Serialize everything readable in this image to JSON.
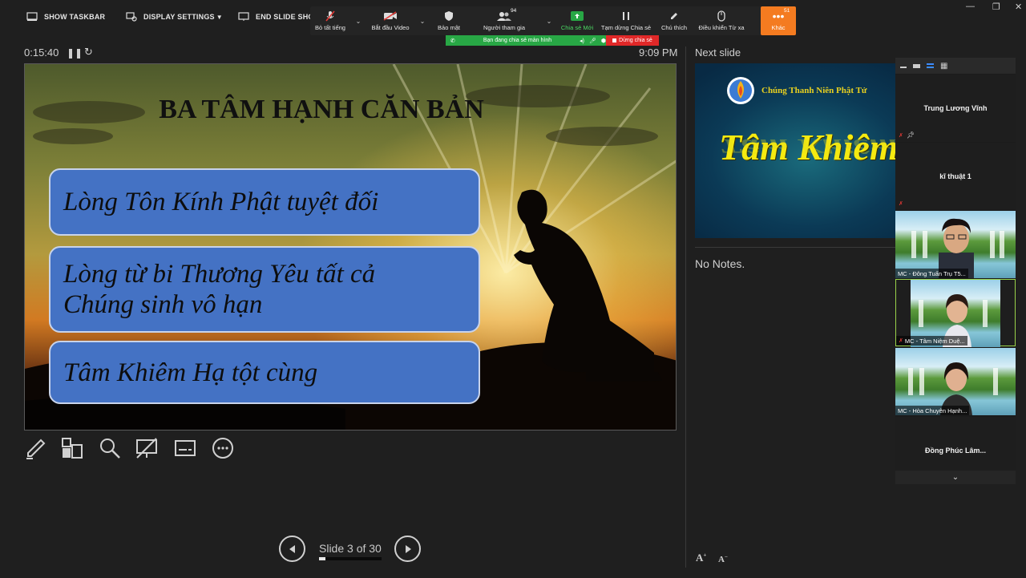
{
  "presenter_toolbar": {
    "show_taskbar": "SHOW TASKBAR",
    "display_settings": "DISPLAY SETTINGS",
    "end_slide_show": "END SLIDE SHOW"
  },
  "zoom_toolbar": {
    "mute_all": "Bỏ tất tiếng",
    "start_video": "Bắt đầu Video",
    "security": "Bảo mật",
    "participants": "Người tham gia",
    "participant_count": "94",
    "new_share": "Chia sẻ Mới",
    "pause_share": "Tạm dừng Chia sẻ",
    "annotate": "Chú thích",
    "remote_control": "Điều khiển Từ xa",
    "more": "Khác",
    "more_count": "51"
  },
  "share_banner": {
    "sharing_text": "Bạn đang chia sẻ màn hình",
    "stop_share": "Dừng chia sẻ"
  },
  "presenter": {
    "elapsed": "0:15:40",
    "clock": "9:09 PM",
    "next_slide_label": "Next slide",
    "no_notes": "No Notes.",
    "slide_counter": "Slide 3 of 30",
    "progress_fraction": 0.1
  },
  "current_slide": {
    "title": "BA TÂM HẠNH CĂN BẢN",
    "boxes": [
      {
        "line1": "Lòng Tôn Kính Phật tuyệt đối",
        "line2": ""
      },
      {
        "line1": "Lòng từ bi Thương Yêu tất cả",
        "line2": "Chúng sinh vô hạn"
      },
      {
        "line1": "Tâm Khiêm Hạ tột cùng",
        "line2": ""
      }
    ]
  },
  "next_slide": {
    "org": "Chúng Thanh Niên Phật Tử",
    "big_text": "Tâm Khiêm"
  },
  "participants": [
    {
      "name": "Trung Lương Vĩnh",
      "video": false
    },
    {
      "name": "kĩ thuật 1",
      "video": false
    },
    {
      "name": "MC - Đông Tuấn Trụ T5...",
      "video": true
    },
    {
      "name": "MC - Tâm Niệm Duệ...",
      "video": true
    },
    {
      "name": "MC - Hòa Chuyên Hạnh...",
      "video": true
    },
    {
      "name": "Đồng Phúc Lâm...",
      "video": false
    }
  ],
  "colors": {
    "zoom_green": "#28a745",
    "zoom_red": "#e02828",
    "zoom_orange": "#f47b20",
    "slide_box_blue": "#4472c4",
    "next_slide_yellow": "#f5ea10"
  }
}
